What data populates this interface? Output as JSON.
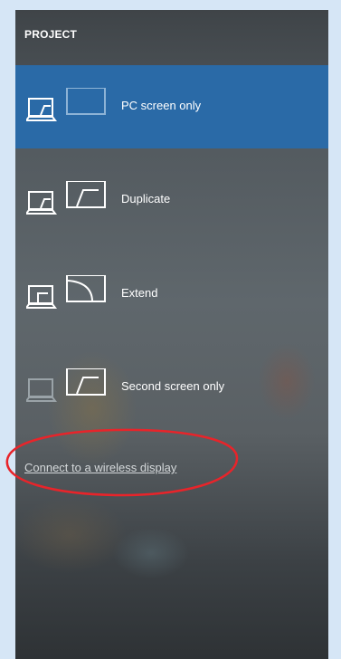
{
  "panel": {
    "title": "PROJECT",
    "options": [
      {
        "label": "PC screen only",
        "icon": "pc-screen-only-icon",
        "selected": true
      },
      {
        "label": "Duplicate",
        "icon": "duplicate-icon",
        "selected": false
      },
      {
        "label": "Extend",
        "icon": "extend-icon",
        "selected": false
      },
      {
        "label": "Second screen only",
        "icon": "second-screen-only-icon",
        "selected": false
      }
    ],
    "wireless_link": "Connect to a wireless display"
  },
  "colors": {
    "accent_selected": "#2a6aa7",
    "annotation": "#e8242a"
  }
}
